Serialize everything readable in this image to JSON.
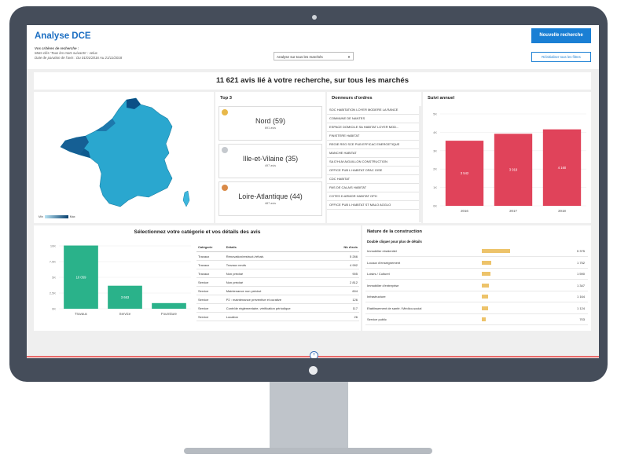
{
  "app": {
    "title": "Analyse DCE",
    "criteria_title": "Vos critères de recherche :",
    "criteria_keywords": "Mots-clés 'Tous les mots suivants' : velux",
    "criteria_dates": "Date de parution de l'avis : Du 01/01/2016 Au 21/11/2018",
    "market_select": "Analyse sur tous les marchés",
    "new_search_label": "Nouvelle recherche",
    "reset_filters_label": "Réinitialiser tous les filtres"
  },
  "banner": "11 621 avis lié à votre recherche, sur tous les marchés",
  "map": {
    "legend_min": "Min",
    "legend_max": "Max",
    "colors": {
      "low": "#b8e2f2",
      "mid": "#2aa7cf",
      "high": "#07406e"
    }
  },
  "top3": {
    "title": "Top 3",
    "items": [
      {
        "name": "Nord (59)",
        "sub": "691 avis",
        "medal": "gold-medal-icon"
      },
      {
        "name": "Ille-et-Vilaine (35)",
        "sub": "497 avis",
        "medal": "silver-medal-icon"
      },
      {
        "name": "Loire-Atlantique (44)",
        "sub": "487 avis",
        "medal": "bronze-medal-icon"
      }
    ]
  },
  "donneurs": {
    "title": "Donneurs d'ordres",
    "items": [
      "SOC HABITATION LOYER MODERE LA RANCE",
      "COMMUNE DE NANTES",
      "ESPACE DOMICILE SA HABITAT LOYER MOD...",
      "FINISTERE HABITAT",
      "REGIE REG SCE PUB EFFICAC ENERGETIQUE",
      "MANCHE HABITAT",
      "SA D'HLM AIGUILLON CONSTRUCTION",
      "OFFICE PUB L HABITAT OPAC OISE",
      "CDC HABITAT",
      "PAS DE CALAIS HABITAT",
      "COTES D ARMOR HABITAT OPH",
      "OFFICE PUB L HABITAT ST MALO AGGLO"
    ]
  },
  "suivi": {
    "title": "Suivi annuel"
  },
  "categories": {
    "title": "Sélectionnez votre catégorie et vos détails des avis",
    "table": {
      "headers": [
        "Catégorie",
        "Détails",
        "Nb d'avis"
      ],
      "rows": [
        [
          "Travaux",
          "Rénovation/restruct./réhab.",
          "5 266"
        ],
        [
          "Travaux",
          "Travaux neufs",
          "4 992"
        ],
        [
          "Travaux",
          "Non précisé",
          "905"
        ],
        [
          "Service",
          "Non précisé",
          "2 812"
        ],
        [
          "Service",
          "Maintenance non précisé",
          "604"
        ],
        [
          "Service",
          "P2 : maintenance préventive et curative",
          "126"
        ],
        [
          "Service",
          "Contrôle réglementaire, vérification périodique",
          "117"
        ],
        [
          "Service",
          "Location",
          "26"
        ]
      ]
    }
  },
  "nature": {
    "title": "Nature de la construction",
    "subtitle": "Double cliquer pour plus de détails",
    "bar_color": "#edc36a",
    "rows": [
      {
        "label": "Immobilier résidentiel",
        "value": "5 375",
        "n": 5375
      },
      {
        "label": "Locaux d'enseignement",
        "value": "1 752",
        "n": 1752
      },
      {
        "label": "Loisirs / Culturel",
        "value": "1 590",
        "n": 1590
      },
      {
        "label": "Immobilier d'entreprise",
        "value": "1 347",
        "n": 1347
      },
      {
        "label": "Infrastructure",
        "value": "1 164",
        "n": 1164
      },
      {
        "label": "Etablissement de santé / Médico-social",
        "value": "1 124",
        "n": 1124
      },
      {
        "label": "Service public",
        "value": "703",
        "n": 703
      }
    ]
  },
  "chart_data": [
    {
      "type": "bar",
      "categories": [
        "2016",
        "2017",
        "2018"
      ],
      "values": [
        3542,
        3919,
        4160
      ],
      "data_labels": [
        "3 542",
        "3 919",
        "4 160"
      ],
      "ylim": [
        0,
        5000
      ],
      "yticks": [
        "0K",
        "1K",
        "2K",
        "3K",
        "4K",
        "5K"
      ],
      "color": "#e0435a"
    },
    {
      "type": "bar",
      "categories": [
        "Travaux",
        "Service",
        "Fourniture"
      ],
      "values": [
        10059,
        3663,
        900
      ],
      "data_labels": [
        "10 059",
        "3 663",
        ""
      ],
      "ylim": [
        0,
        10000
      ],
      "yticks": [
        "0K",
        "2,5K",
        "5K",
        "7,5K",
        "10K"
      ],
      "color": "#2ab28a"
    }
  ]
}
